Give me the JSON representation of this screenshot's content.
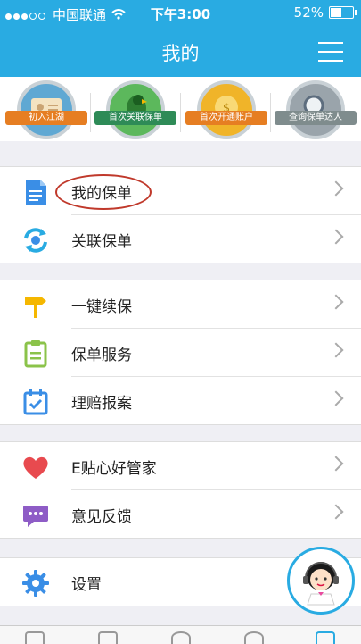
{
  "status_bar": {
    "carrier": "中国联通",
    "time": "下午3:00",
    "battery": "52%",
    "battery_level": 0.52
  },
  "header": {
    "title": "我的",
    "menu_icon": "menu-icon"
  },
  "badges": [
    {
      "label": "初入江湖",
      "icon": "id-card-icon",
      "color": "#5fa8d3",
      "ribbon": "#e67e22"
    },
    {
      "label": "首次关联保单",
      "icon": "parrot-icon",
      "color": "#5cb85c",
      "ribbon": "#2e8b57"
    },
    {
      "label": "首次开通账户",
      "icon": "coin-icon",
      "color": "#f0b429",
      "ribbon": "#e67e22"
    },
    {
      "label": "查询保单达人",
      "icon": "magnifier-icon",
      "color": "#9aa4ab",
      "ribbon": "#7f8c8d"
    }
  ],
  "groups": [
    {
      "items": [
        {
          "label": "我的保单",
          "icon": "document-icon",
          "color": "#3a8ee6",
          "highlighted": true
        },
        {
          "label": "关联保单",
          "icon": "sync-icon",
          "color": "#29abe2"
        }
      ]
    },
    {
      "items": [
        {
          "label": "一键续保",
          "icon": "signpost-icon",
          "color": "#f5b700"
        },
        {
          "label": "保单服务",
          "icon": "clipboard-icon",
          "color": "#8bc34a"
        },
        {
          "label": "理赔报案",
          "icon": "calendar-check-icon",
          "color": "#3a8ee6"
        }
      ]
    },
    {
      "items": [
        {
          "label": "E贴心好管家",
          "icon": "heart-icon",
          "color": "#e84a4f"
        },
        {
          "label": "意见反馈",
          "icon": "chat-bubble-icon",
          "color": "#8e5cc6"
        }
      ]
    },
    {
      "items": [
        {
          "label": "设置",
          "icon": "gear-icon",
          "color": "#3a8ee6"
        }
      ]
    }
  ],
  "customer_service": {
    "icon": "customer-service-avatar-icon"
  },
  "tab_bar": {
    "icons": [
      "home-icon",
      "box-icon",
      "compass-icon",
      "person-icon",
      "list-icon"
    ]
  }
}
